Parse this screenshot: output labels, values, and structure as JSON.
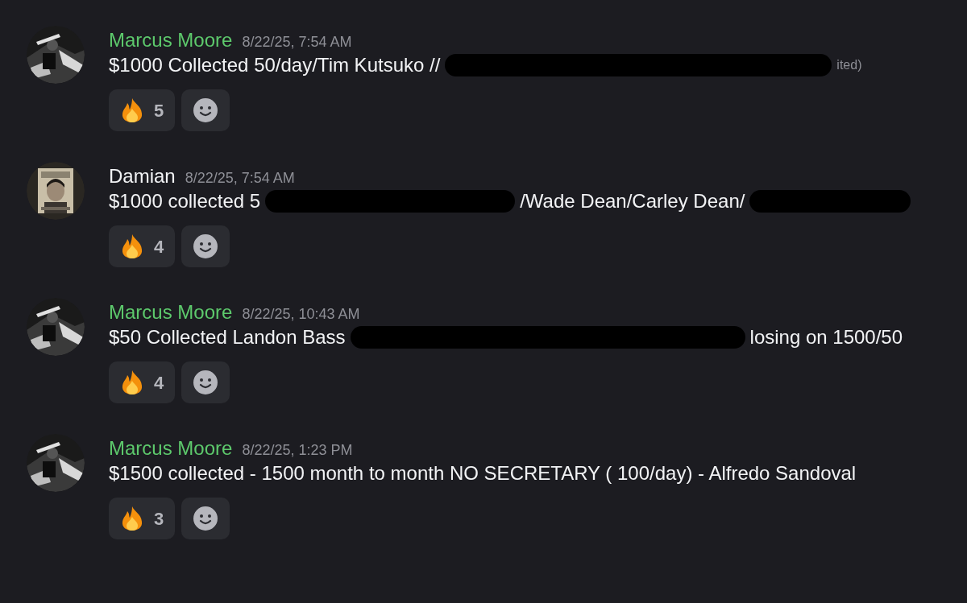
{
  "messages": [
    {
      "author": "Marcus Moore",
      "color": "#5dc96c",
      "timestamp": "8/22/25, 7:54 AM",
      "segments": [
        {
          "kind": "text",
          "text": "$1000 Collected 50/day/Tim Kutsuko //"
        },
        {
          "kind": "redaction"
        },
        {
          "kind": "note",
          "text": "ited)"
        }
      ],
      "reactions": [
        {
          "count": "5"
        }
      ]
    },
    {
      "author": "Damian",
      "color": "#f2f3f5",
      "timestamp": "8/22/25, 7:54 AM",
      "segments": [
        {
          "kind": "text",
          "text": "$1000 collected 5"
        },
        {
          "kind": "redaction"
        },
        {
          "kind": "text",
          "text": "/Wade Dean/Carley Dean/"
        },
        {
          "kind": "redaction"
        }
      ],
      "reactions": [
        {
          "count": "4"
        }
      ]
    },
    {
      "author": "Marcus Moore",
      "color": "#5dc96c",
      "timestamp": "8/22/25, 10:43 AM",
      "segments": [
        {
          "kind": "text",
          "text": "$50 Collected Landon Bass"
        },
        {
          "kind": "redaction"
        },
        {
          "kind": "text",
          "text": "losing on 1500/50"
        }
      ],
      "reactions": [
        {
          "count": "4"
        }
      ]
    },
    {
      "author": "Marcus Moore",
      "color": "#5dc96c",
      "timestamp": "8/22/25, 1:23 PM",
      "segments": [
        {
          "kind": "text",
          "text": "$1500 collected - 1500 month to month NO SECRETARY ( 100/day) - Alfredo Sandoval"
        }
      ],
      "reactions": [
        {
          "count": "3"
        }
      ]
    }
  ]
}
